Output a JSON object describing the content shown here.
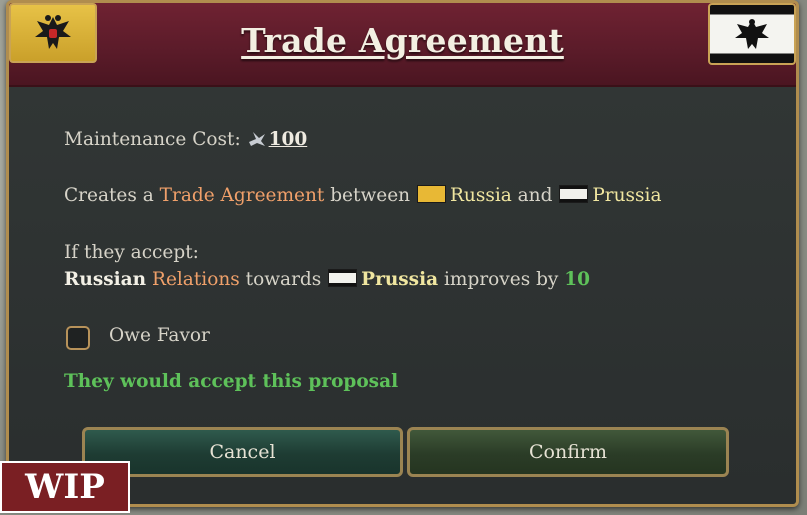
{
  "dialog": {
    "title": "Trade Agreement",
    "left_flag_icon": "russia-flag-icon",
    "right_flag_icon": "prussia-flag-icon"
  },
  "maintenance": {
    "label": "Maintenance Cost:",
    "icon": "influence-icon",
    "value": "100"
  },
  "creates": {
    "prefix": "Creates a",
    "agreement": "Trade Agreement",
    "between": "between",
    "country_a": "Russia",
    "and": "and",
    "country_b": "Prussia"
  },
  "if_accept": {
    "heading": "If they accept:",
    "subject": "Russian",
    "relations": "Relations",
    "towards": "towards",
    "target": "Prussia",
    "improves": "improves by",
    "amount": "10"
  },
  "owe_favor": {
    "label": "Owe Favor",
    "checked": false
  },
  "status": "They would accept this proposal",
  "buttons": {
    "cancel": "Cancel",
    "confirm": "Confirm"
  },
  "wip_badge": "WIP",
  "colors": {
    "header": "#5a1b29",
    "accent_gold": "#b08d4e",
    "positive_green": "#5ec15a",
    "highlight_orange": "#f0a06a",
    "country_yellow": "#f0e6a0"
  }
}
